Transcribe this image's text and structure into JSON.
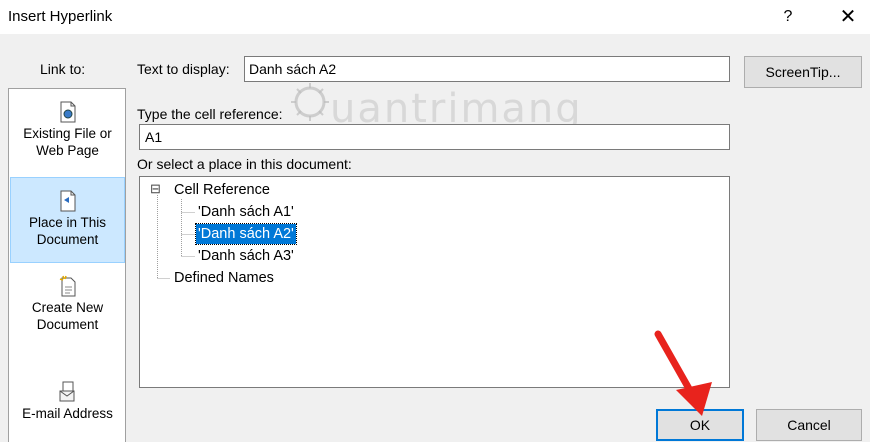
{
  "window": {
    "title": "Insert Hyperlink",
    "help": "?",
    "close": "✕"
  },
  "link_to": {
    "label": "Link to:",
    "items": [
      {
        "line1": "Existing File or",
        "line2": "Web Page",
        "icon": "file-globe-icon"
      },
      {
        "line1": "Place in This",
        "line2": "Document",
        "icon": "document-place-icon",
        "selected": true
      },
      {
        "line1": "Create New",
        "line2": "Document",
        "icon": "new-document-icon"
      },
      {
        "line1": "E-mail Address",
        "line2": "",
        "icon": "email-icon"
      }
    ]
  },
  "text_to_display": {
    "label": "Text to display:",
    "value": "Danh sách A2"
  },
  "screentip_button": "ScreenTip...",
  "cell_reference": {
    "label": "Type the cell reference:",
    "value": "A1"
  },
  "place_label": "Or select a place in this document:",
  "tree": {
    "root_toggle": "⊟",
    "root": "Cell Reference",
    "children": [
      "'Danh sách A1'",
      "'Danh sách A2'",
      "'Danh sách A3'"
    ],
    "selected_index": 1,
    "defined_names": "Defined Names"
  },
  "buttons": {
    "ok": "OK",
    "cancel": "Cancel"
  },
  "watermark": "uantrimang",
  "colors": {
    "selection": "#0078d7",
    "nav_selected": "#cce8ff",
    "arrow": "#e8231d"
  }
}
